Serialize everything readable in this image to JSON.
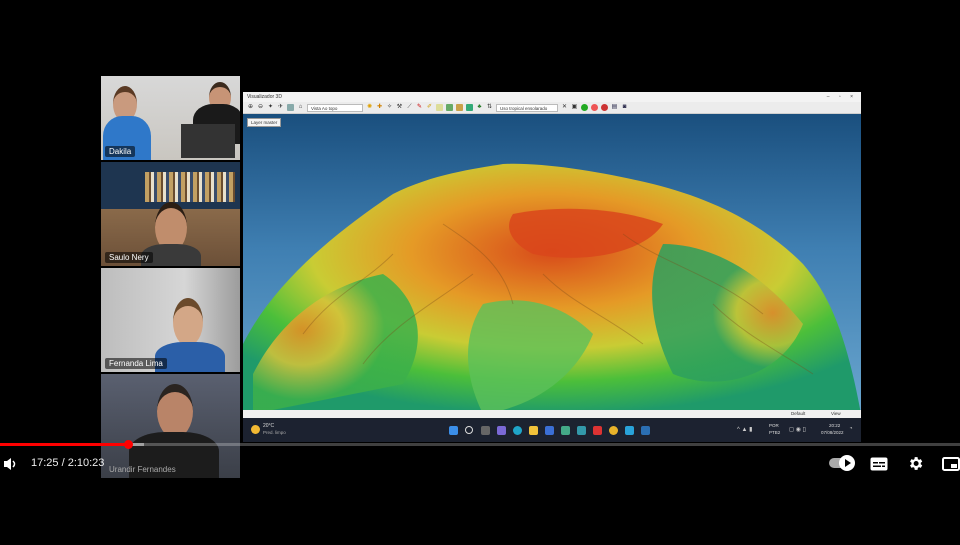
{
  "participants": [
    {
      "name": "Dakila"
    },
    {
      "name": "Saulo Nery"
    },
    {
      "name": "Fernanda Lima"
    },
    {
      "name": "Urandir Fernandes"
    }
  ],
  "app": {
    "title": "Visualizador 3D",
    "view_select": "Vista Ao topo",
    "palette_select": "Uso tropical ensolarado",
    "layer_button": "Layer master",
    "status_left": "Default",
    "status_right": "View"
  },
  "taskbar": {
    "weather_temp": "20°C",
    "weather_desc": "Pred. limpo",
    "lang": "POR",
    "lang2": "PTB2",
    "time": "20:22",
    "date": "07/08/2022"
  },
  "player": {
    "time_display": "17:25 / 2:10:23",
    "progress_fraction": 0.133,
    "buffer_fraction": 0.15,
    "autoplay_on": true,
    "accent": "#ff0000"
  }
}
